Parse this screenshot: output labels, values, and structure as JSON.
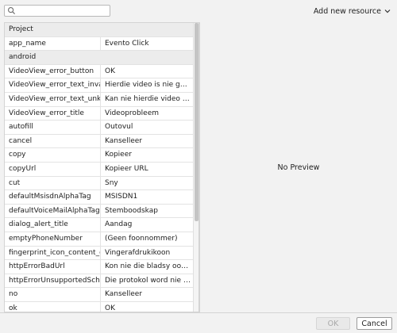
{
  "search": {
    "placeholder": "",
    "value": ""
  },
  "header": {
    "add_resource_label": "Add new resource"
  },
  "table": {
    "rows": [
      {
        "type": "group",
        "key": "Project",
        "value": ""
      },
      {
        "type": "item",
        "key": "app_name",
        "value": "Evento Click"
      },
      {
        "type": "group",
        "key": "android",
        "value": ""
      },
      {
        "type": "item",
        "key": "VideoView_error_button",
        "value": "OK"
      },
      {
        "type": "item",
        "key": "VideoView_error_text_invalid",
        "value": "Hierdie video is nie geldig ..."
      },
      {
        "type": "item",
        "key": "VideoView_error_text_unknown",
        "value": "Kan nie hierdie video speel ..."
      },
      {
        "type": "item",
        "key": "VideoView_error_title",
        "value": "Videoprobleem"
      },
      {
        "type": "item",
        "key": "autofill",
        "value": "Outovul"
      },
      {
        "type": "item",
        "key": "cancel",
        "value": "Kanselleer"
      },
      {
        "type": "item",
        "key": "copy",
        "value": "Kopieer"
      },
      {
        "type": "item",
        "key": "copyUrl",
        "value": "Kopieer URL"
      },
      {
        "type": "item",
        "key": "cut",
        "value": "Sny"
      },
      {
        "type": "item",
        "key": "defaultMsisdnAlphaTag",
        "value": "MSISDN1"
      },
      {
        "type": "item",
        "key": "defaultVoiceMailAlphaTag",
        "value": "Stemboodskap"
      },
      {
        "type": "item",
        "key": "dialog_alert_title",
        "value": "Aandag"
      },
      {
        "type": "item",
        "key": "emptyPhoneNumber",
        "value": "(Geen foonnommer)"
      },
      {
        "type": "item",
        "key": "fingerprint_icon_content_description",
        "value": "Vingerafdrukikoon"
      },
      {
        "type": "item",
        "key": "httpErrorBadUrl",
        "value": "Kon nie die bladsy oop ma..."
      },
      {
        "type": "item",
        "key": "httpErrorUnsupportedScheme",
        "value": "Die protokol word nie ond..."
      },
      {
        "type": "item",
        "key": "no",
        "value": "Kanselleer"
      },
      {
        "type": "item",
        "key": "ok",
        "value": "OK"
      }
    ]
  },
  "preview": {
    "text": "No Preview"
  },
  "footer": {
    "ok_label": "OK",
    "cancel_label": "Cancel"
  },
  "colors": {
    "background": "#f2f2f2",
    "group_row": "#ececec",
    "disabled_text": "#a8a8a8"
  }
}
